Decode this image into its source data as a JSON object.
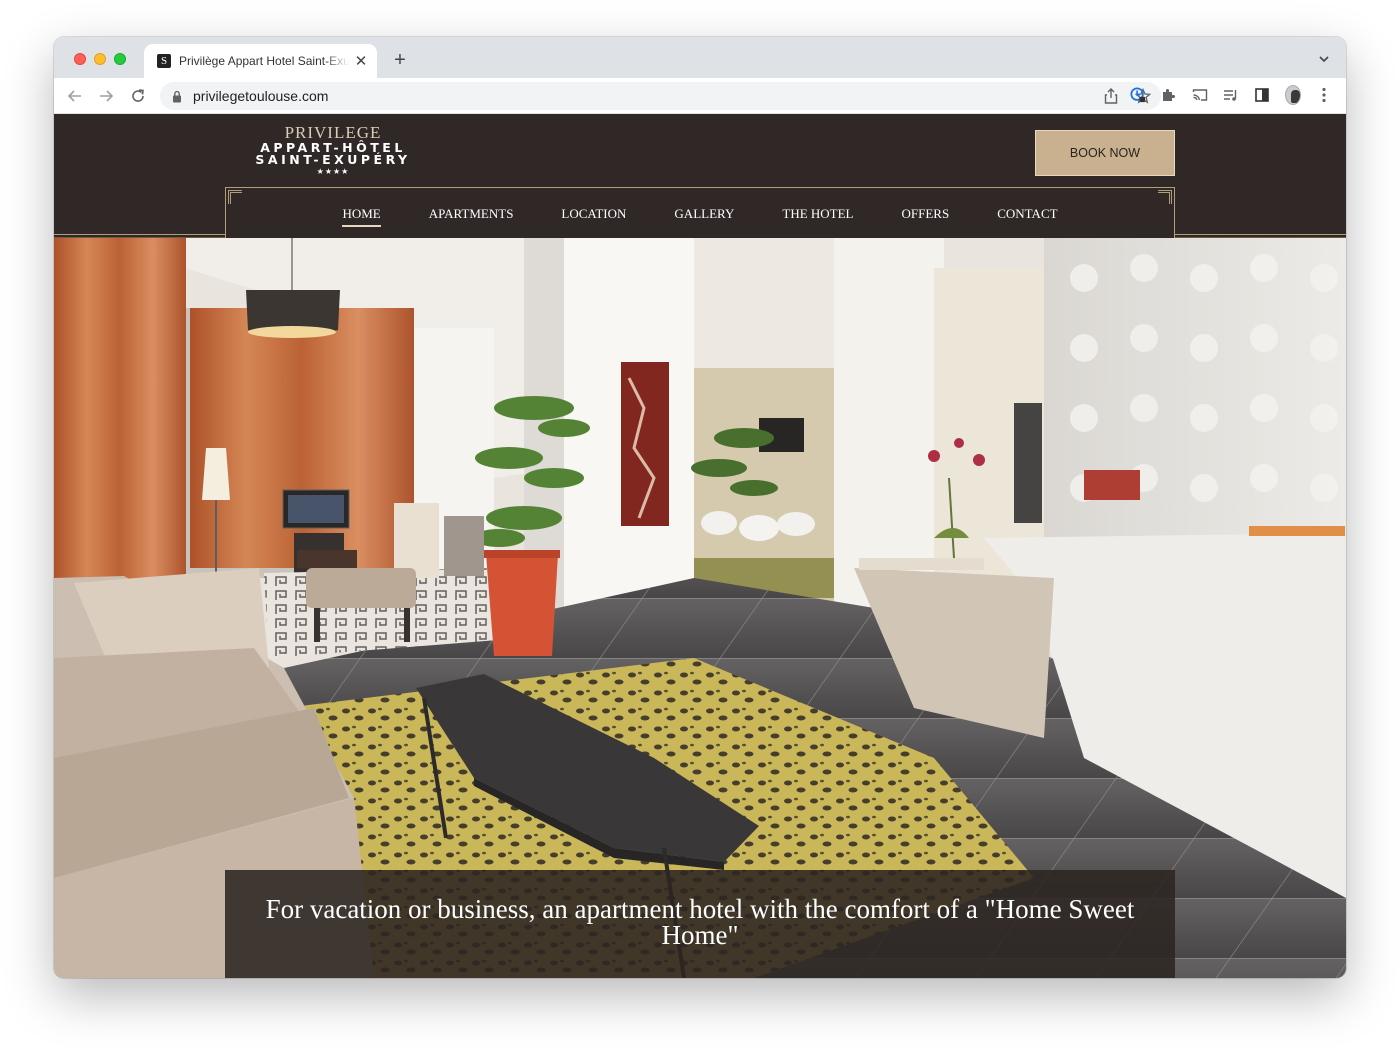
{
  "browser": {
    "tab_favicon": "S",
    "tab_title": "Privilège Appart Hotel Saint-Exupéry",
    "new_tab_label": "+",
    "url": "privilegetoulouse.com"
  },
  "site": {
    "logo": {
      "line1": "PRIVILEGE",
      "line2": "APPART-HÔTEL",
      "line3": "SAINT-EXUPÉRY",
      "stars": "★★★★"
    },
    "book_now": "BOOK NOW",
    "nav": [
      {
        "label": "HOME",
        "active": true
      },
      {
        "label": "APARTMENTS",
        "active": false
      },
      {
        "label": "LOCATION",
        "active": false
      },
      {
        "label": "GALLERY",
        "active": false
      },
      {
        "label": "THE HOTEL",
        "active": false
      },
      {
        "label": "OFFERS",
        "active": false
      },
      {
        "label": "CONTACT",
        "active": false
      }
    ],
    "hero_caption": "For vacation or business, an apartment hotel with the comfort of a \"Home Sweet Home\""
  },
  "colors": {
    "header_bg": "#2f2826",
    "gold": "#b39d78",
    "book_now_bg": "#c9b190",
    "curtain": "#c56a3a",
    "planter": "#d24a2a"
  },
  "icons": [
    "back-arrow-icon",
    "forward-arrow-icon",
    "reload-icon",
    "lock-icon",
    "share-icon",
    "star-icon",
    "extension-icon",
    "puzzle-icon",
    "cast-icon",
    "media-icon",
    "sidepanel-icon",
    "menu-dots-icon",
    "tab-close-icon",
    "chevron-down-icon"
  ]
}
